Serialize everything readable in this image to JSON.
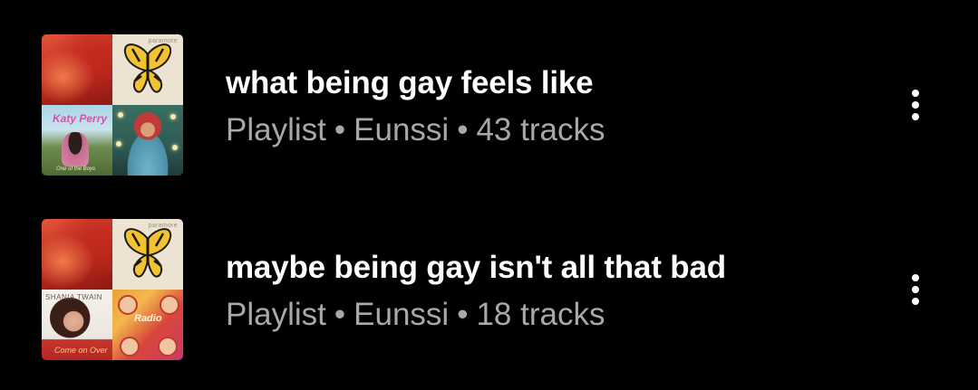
{
  "playlists": [
    {
      "title": "what being gay feels like",
      "type": "Playlist",
      "owner": "Eunssi",
      "tracks": "43 tracks",
      "artwork": {
        "tiles": [
          "red-abstract-cover",
          "butterfly-cover",
          "katy-perry-cover",
          "marina-cover"
        ],
        "butterfly_text": "paramore",
        "katy_logo": "Katy Perry",
        "katy_caption": "One of the Boys"
      }
    },
    {
      "title": "maybe being gay isn't all that bad",
      "type": "Playlist",
      "owner": "Eunssi",
      "tracks": "18 tracks",
      "artwork": {
        "tiles": [
          "red-abstract-cover",
          "butterfly-cover",
          "shania-twain-cover",
          "radio-cover"
        ],
        "butterfly_text": "paramore",
        "shania_name": "SHANIA TWAIN",
        "shania_script": "Come on Over",
        "radio_title": "Radio"
      }
    }
  ],
  "separator": "•",
  "icons": {
    "more": "more-vertical-icon"
  },
  "colors": {
    "background": "#000000",
    "title": "#ffffff",
    "subtitle": "#a8a8a8"
  }
}
